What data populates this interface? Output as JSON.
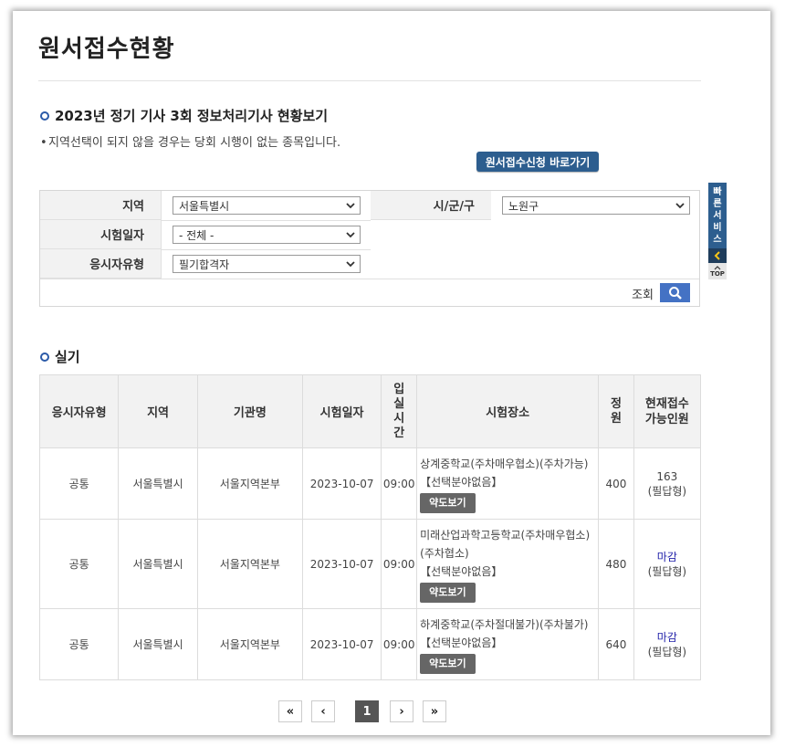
{
  "page_title": "원서접수현황",
  "section1": {
    "title": "2023년 정기 기사 3회 정보처리기사 현황보기",
    "notice": "지역선택이 되지 않을 경우는 당회 시행이 없는 종목입니다.",
    "apply_button": "원서접수신청 바로가기"
  },
  "search": {
    "region_label": "지역",
    "region_value": "서울특별시",
    "city_label": "시/군/구",
    "city_value": "노원구",
    "date_label": "시험일자",
    "date_value": "- 전체 -",
    "type_label": "응시자유형",
    "type_value": "필기합격자",
    "query_label": "조회"
  },
  "section2": {
    "title": "실기"
  },
  "table": {
    "headers": {
      "type": "응시자유형",
      "region": "지역",
      "org": "기관명",
      "date": "시험일자",
      "entry_time_lines": [
        "입",
        "실",
        "시",
        "간"
      ],
      "place": "시험장소",
      "capacity_lines": [
        "정",
        "원"
      ],
      "current_lines": [
        "현재접수",
        "가능인원"
      ]
    },
    "rows": [
      {
        "type": "공통",
        "region": "서울특별시",
        "org": "서울지역본부",
        "date": "2023-10-07",
        "time": "09:00",
        "place": "상계중학교(주차매우협소)(주차가능)",
        "place_sub": "【선택분야없음】",
        "map_button": "약도보기",
        "capacity": "400",
        "current": "163",
        "current_sub": "(필답형)",
        "closed": false
      },
      {
        "type": "공통",
        "region": "서울특별시",
        "org": "서울지역본부",
        "date": "2023-10-07",
        "time": "09:00",
        "place": "미래산업과학고등학교(주차매우협소)(주차협소)",
        "place_sub": "【선택분야없음】",
        "map_button": "약도보기",
        "capacity": "480",
        "current": "마감",
        "current_sub": "(필답형)",
        "closed": true
      },
      {
        "type": "공통",
        "region": "서울특별시",
        "org": "서울지역본부",
        "date": "2023-10-07",
        "time": "09:00",
        "place": "하계중학교(주차절대불가)(주차불가)",
        "place_sub": "【선택분야없음】",
        "map_button": "약도보기",
        "capacity": "640",
        "current": "마감",
        "current_sub": "(필답형)",
        "closed": true
      }
    ]
  },
  "pagination": {
    "first": "«",
    "prev": "‹",
    "current": "1",
    "next": "›",
    "last": "»"
  },
  "quick_service": {
    "chars": [
      "빠",
      "른",
      "서",
      "비",
      "스"
    ],
    "top_label": "TOP"
  },
  "colors": {
    "accent": "#2d5e8f",
    "search_button": "#4472c4",
    "closed_text": "#2222aa"
  }
}
